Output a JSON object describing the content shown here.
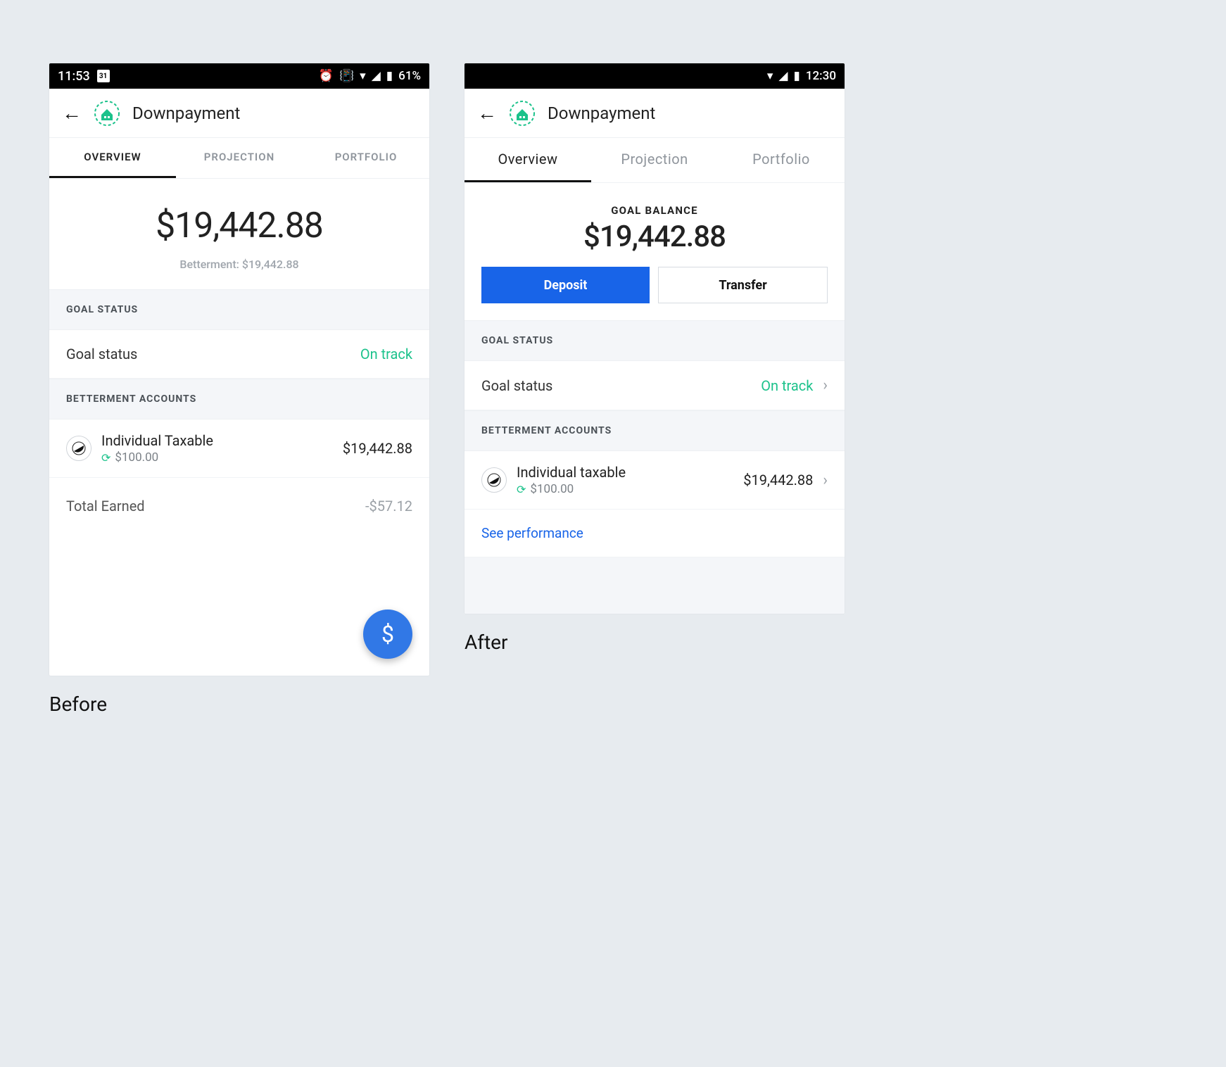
{
  "before": {
    "caption": "Before",
    "status": {
      "time": "11:53",
      "calendar_day": "31",
      "battery": "61%"
    },
    "header": {
      "title": "Downpayment"
    },
    "tabs": [
      "OVERVIEW",
      "PROJECTION",
      "PORTFOLIO"
    ],
    "balance": {
      "amount": "$19,442.88",
      "sub": "Betterment: $19,442.88"
    },
    "sections": {
      "goal_status_head": "GOAL STATUS",
      "goal_status_label": "Goal status",
      "goal_status_value": "On track",
      "accounts_head": "BETTERMENT ACCOUNTS",
      "account_name": "Individual Taxable",
      "account_sub": "$100.00",
      "account_amount": "$19,442.88",
      "total_label": "Total Earned",
      "total_value": "-$57.12"
    },
    "fab": "$"
  },
  "after": {
    "caption": "After",
    "status": {
      "time": "12:30"
    },
    "header": {
      "title": "Downpayment"
    },
    "tabs": [
      "Overview",
      "Projection",
      "Portfolio"
    ],
    "balance": {
      "label": "GOAL BALANCE",
      "amount": "$19,442.88"
    },
    "actions": {
      "deposit": "Deposit",
      "transfer": "Transfer"
    },
    "sections": {
      "goal_status_head": "GOAL STATUS",
      "goal_status_label": "Goal status",
      "goal_status_value": "On track",
      "accounts_head": "BETTERMENT ACCOUNTS",
      "account_name": "Individual taxable",
      "account_sub": "$100.00",
      "account_amount": "$19,442.88",
      "performance_link": "See performance"
    }
  }
}
